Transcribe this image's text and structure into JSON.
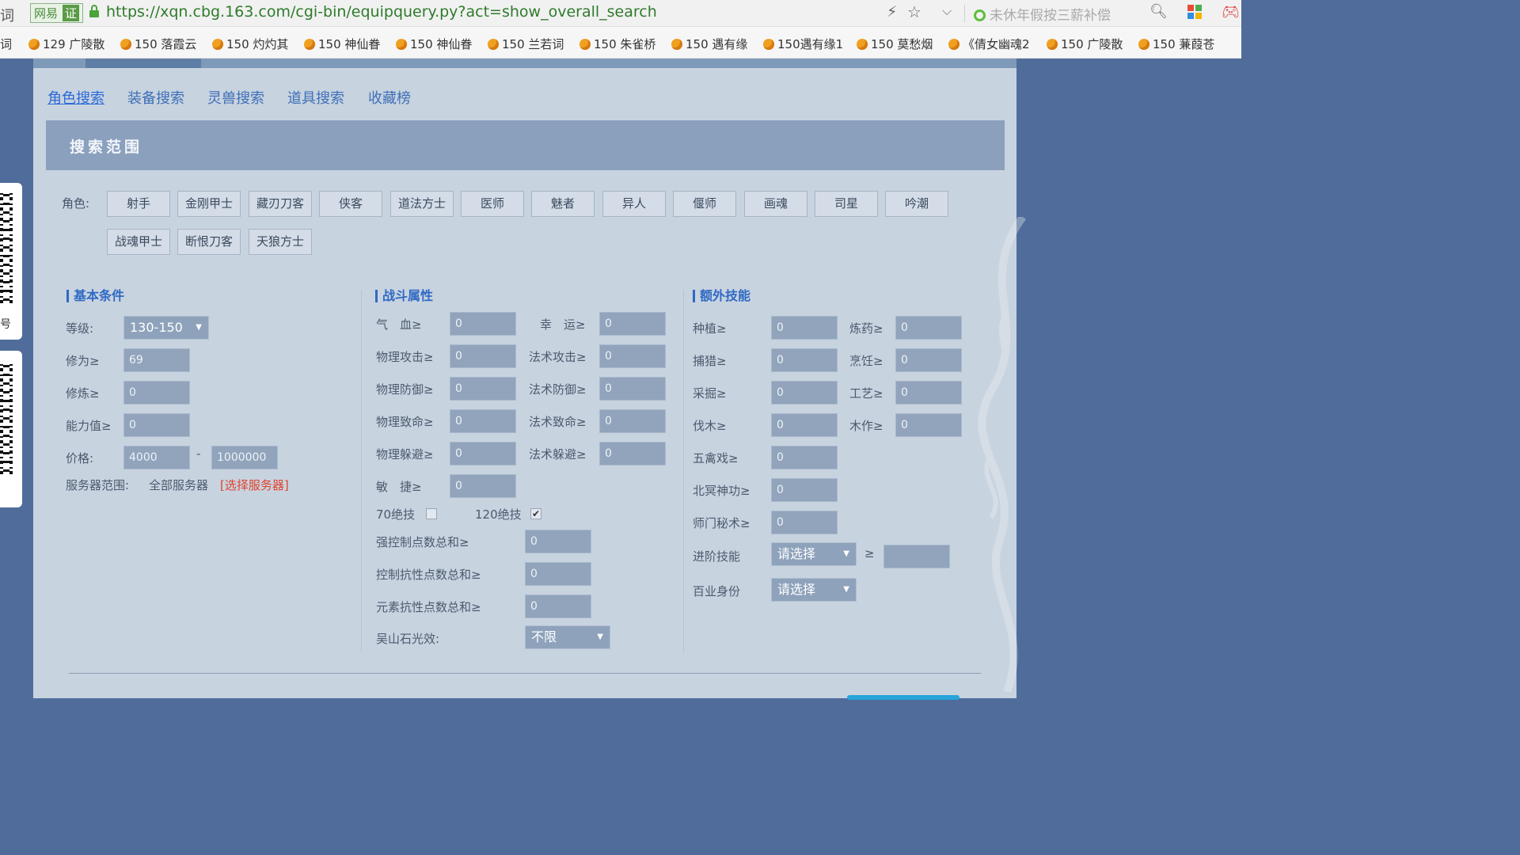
{
  "browser": {
    "badge_brand": "网易",
    "badge_cert": "证",
    "url": "https://xqn.cbg.163.com/cgi-bin/equipquery.py?act=show_overall_search",
    "search_hint": "未休年假按三薪补偿",
    "left_edge_text": "词"
  },
  "bookmarks": [
    "129 广陵散",
    "150 落霞云",
    "150 灼灼其",
    "150 神仙眷",
    "150 神仙眷",
    "150 兰若词",
    "150 朱雀桥",
    "150 遇有缘",
    "150遇有缘1",
    "150 莫愁烟",
    "《倩女幽魂2",
    "150 广陵散",
    "150 蒹葭苍"
  ],
  "tabs": [
    "角色搜索",
    "装备搜索",
    "灵兽搜索",
    "道具搜索",
    "收藏榜"
  ],
  "panel_title": "搜索范围",
  "roles": {
    "label": "角色:",
    "row1": [
      "射手",
      "金刚甲士",
      "藏刃刀客",
      "侠客",
      "道法方士",
      "医师",
      "魅者",
      "异人",
      "偃师",
      "画魂",
      "司星",
      "吟潮"
    ],
    "row2": [
      "战魂甲士",
      "断恨刀客",
      "天狼方士"
    ]
  },
  "basic": {
    "title": "基本条件",
    "level_label": "等级:",
    "level_value": "130-150",
    "xiuwei_label": "修为≥",
    "xiuwei_value": "69",
    "xiulian_label": "修炼≥",
    "xiulian_value": "0",
    "ability_label": "能力值≥",
    "ability_value": "0",
    "price_label": "价格:",
    "price_min": "4000",
    "price_sep": "-",
    "price_max": "1000000",
    "server_label": "服务器范围:",
    "server_value": "全部服务器",
    "server_link": "[选择服务器]"
  },
  "combat": {
    "title": "战斗属性",
    "rows": [
      {
        "l1": "气　血≥",
        "v1": "0",
        "l2": "幸　运≥",
        "v2": "0"
      },
      {
        "l1": "物理攻击≥",
        "v1": "0",
        "l2": "法术攻击≥",
        "v2": "0"
      },
      {
        "l1": "物理防御≥",
        "v1": "0",
        "l2": "法术防御≥",
        "v2": "0"
      },
      {
        "l1": "物理致命≥",
        "v1": "0",
        "l2": "法术致命≥",
        "v2": "0"
      },
      {
        "l1": "物理躲避≥",
        "v1": "0",
        "l2": "法术躲避≥",
        "v2": "0"
      }
    ],
    "agility_label": "敏　捷≥",
    "agility_value": "0",
    "skill70_label": "70绝技",
    "skill70_checked": false,
    "skill120_label": "120绝技",
    "skill120_checked": true,
    "control_label": "强控制点数总和≥",
    "control_value": "0",
    "resist_label": "控制抗性点数总和≥",
    "resist_value": "0",
    "element_label": "元素抗性点数总和≥",
    "element_value": "0",
    "stone_label": "吴山石光效:",
    "stone_value": "不限"
  },
  "extra": {
    "title": "额外技能",
    "pairs": [
      {
        "l1": "种植≥",
        "v1": "0",
        "l2": "炼药≥",
        "v2": "0"
      },
      {
        "l1": "捕猎≥",
        "v1": "0",
        "l2": "烹饪≥",
        "v2": "0"
      },
      {
        "l1": "采掘≥",
        "v1": "0",
        "l2": "工艺≥",
        "v2": "0"
      },
      {
        "l1": "伐木≥",
        "v1": "0",
        "l2": "木作≥",
        "v2": "0"
      }
    ],
    "singles": [
      {
        "l": "五禽戏≥",
        "v": "0"
      },
      {
        "l": "北冥神功≥",
        "v": "0"
      },
      {
        "l": "师门秘术≥",
        "v": "0"
      }
    ],
    "adv_label": "进阶技能",
    "adv_value": "请选择",
    "adv_ge": "≥",
    "adv_input": "",
    "job_label": "百业身份",
    "job_value": "请选择"
  },
  "side": {
    "qr_text": "号"
  },
  "colors": {
    "accent": "#2f6ac4",
    "page_bg": "#c8d3e0",
    "outer_bg": "#4f6c9b",
    "input_bg": "#91a4bc",
    "link_red": "#e0432a"
  }
}
